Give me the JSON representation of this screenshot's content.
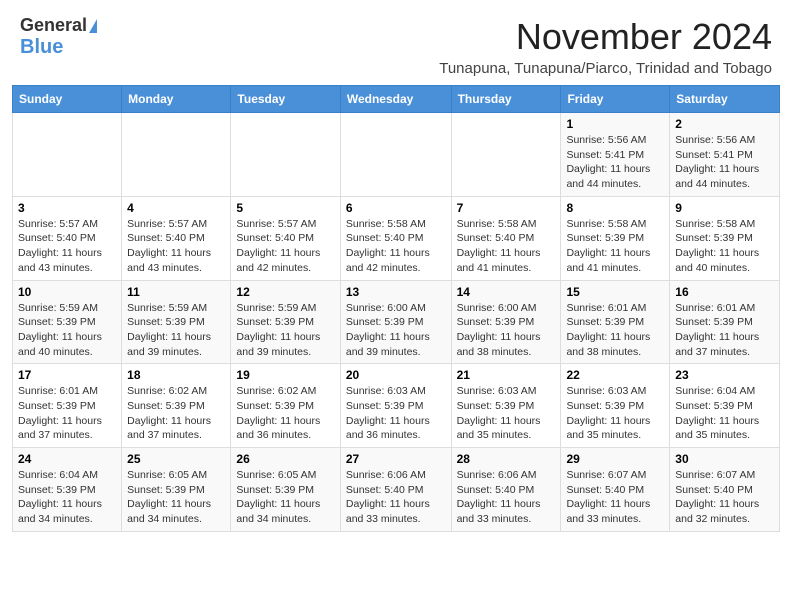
{
  "header": {
    "logo_line1": "General",
    "logo_line2": "Blue",
    "month_title": "November 2024",
    "location": "Tunapuna, Tunapuna/Piarco, Trinidad and Tobago"
  },
  "days_of_week": [
    "Sunday",
    "Monday",
    "Tuesday",
    "Wednesday",
    "Thursday",
    "Friday",
    "Saturday"
  ],
  "weeks": [
    [
      {
        "day": "",
        "info": ""
      },
      {
        "day": "",
        "info": ""
      },
      {
        "day": "",
        "info": ""
      },
      {
        "day": "",
        "info": ""
      },
      {
        "day": "",
        "info": ""
      },
      {
        "day": "1",
        "info": "Sunrise: 5:56 AM\nSunset: 5:41 PM\nDaylight: 11 hours and 44 minutes."
      },
      {
        "day": "2",
        "info": "Sunrise: 5:56 AM\nSunset: 5:41 PM\nDaylight: 11 hours and 44 minutes."
      }
    ],
    [
      {
        "day": "3",
        "info": "Sunrise: 5:57 AM\nSunset: 5:40 PM\nDaylight: 11 hours and 43 minutes."
      },
      {
        "day": "4",
        "info": "Sunrise: 5:57 AM\nSunset: 5:40 PM\nDaylight: 11 hours and 43 minutes."
      },
      {
        "day": "5",
        "info": "Sunrise: 5:57 AM\nSunset: 5:40 PM\nDaylight: 11 hours and 42 minutes."
      },
      {
        "day": "6",
        "info": "Sunrise: 5:58 AM\nSunset: 5:40 PM\nDaylight: 11 hours and 42 minutes."
      },
      {
        "day": "7",
        "info": "Sunrise: 5:58 AM\nSunset: 5:40 PM\nDaylight: 11 hours and 41 minutes."
      },
      {
        "day": "8",
        "info": "Sunrise: 5:58 AM\nSunset: 5:39 PM\nDaylight: 11 hours and 41 minutes."
      },
      {
        "day": "9",
        "info": "Sunrise: 5:58 AM\nSunset: 5:39 PM\nDaylight: 11 hours and 40 minutes."
      }
    ],
    [
      {
        "day": "10",
        "info": "Sunrise: 5:59 AM\nSunset: 5:39 PM\nDaylight: 11 hours and 40 minutes."
      },
      {
        "day": "11",
        "info": "Sunrise: 5:59 AM\nSunset: 5:39 PM\nDaylight: 11 hours and 39 minutes."
      },
      {
        "day": "12",
        "info": "Sunrise: 5:59 AM\nSunset: 5:39 PM\nDaylight: 11 hours and 39 minutes."
      },
      {
        "day": "13",
        "info": "Sunrise: 6:00 AM\nSunset: 5:39 PM\nDaylight: 11 hours and 39 minutes."
      },
      {
        "day": "14",
        "info": "Sunrise: 6:00 AM\nSunset: 5:39 PM\nDaylight: 11 hours and 38 minutes."
      },
      {
        "day": "15",
        "info": "Sunrise: 6:01 AM\nSunset: 5:39 PM\nDaylight: 11 hours and 38 minutes."
      },
      {
        "day": "16",
        "info": "Sunrise: 6:01 AM\nSunset: 5:39 PM\nDaylight: 11 hours and 37 minutes."
      }
    ],
    [
      {
        "day": "17",
        "info": "Sunrise: 6:01 AM\nSunset: 5:39 PM\nDaylight: 11 hours and 37 minutes."
      },
      {
        "day": "18",
        "info": "Sunrise: 6:02 AM\nSunset: 5:39 PM\nDaylight: 11 hours and 37 minutes."
      },
      {
        "day": "19",
        "info": "Sunrise: 6:02 AM\nSunset: 5:39 PM\nDaylight: 11 hours and 36 minutes."
      },
      {
        "day": "20",
        "info": "Sunrise: 6:03 AM\nSunset: 5:39 PM\nDaylight: 11 hours and 36 minutes."
      },
      {
        "day": "21",
        "info": "Sunrise: 6:03 AM\nSunset: 5:39 PM\nDaylight: 11 hours and 35 minutes."
      },
      {
        "day": "22",
        "info": "Sunrise: 6:03 AM\nSunset: 5:39 PM\nDaylight: 11 hours and 35 minutes."
      },
      {
        "day": "23",
        "info": "Sunrise: 6:04 AM\nSunset: 5:39 PM\nDaylight: 11 hours and 35 minutes."
      }
    ],
    [
      {
        "day": "24",
        "info": "Sunrise: 6:04 AM\nSunset: 5:39 PM\nDaylight: 11 hours and 34 minutes."
      },
      {
        "day": "25",
        "info": "Sunrise: 6:05 AM\nSunset: 5:39 PM\nDaylight: 11 hours and 34 minutes."
      },
      {
        "day": "26",
        "info": "Sunrise: 6:05 AM\nSunset: 5:39 PM\nDaylight: 11 hours and 34 minutes."
      },
      {
        "day": "27",
        "info": "Sunrise: 6:06 AM\nSunset: 5:40 PM\nDaylight: 11 hours and 33 minutes."
      },
      {
        "day": "28",
        "info": "Sunrise: 6:06 AM\nSunset: 5:40 PM\nDaylight: 11 hours and 33 minutes."
      },
      {
        "day": "29",
        "info": "Sunrise: 6:07 AM\nSunset: 5:40 PM\nDaylight: 11 hours and 33 minutes."
      },
      {
        "day": "30",
        "info": "Sunrise: 6:07 AM\nSunset: 5:40 PM\nDaylight: 11 hours and 32 minutes."
      }
    ]
  ]
}
